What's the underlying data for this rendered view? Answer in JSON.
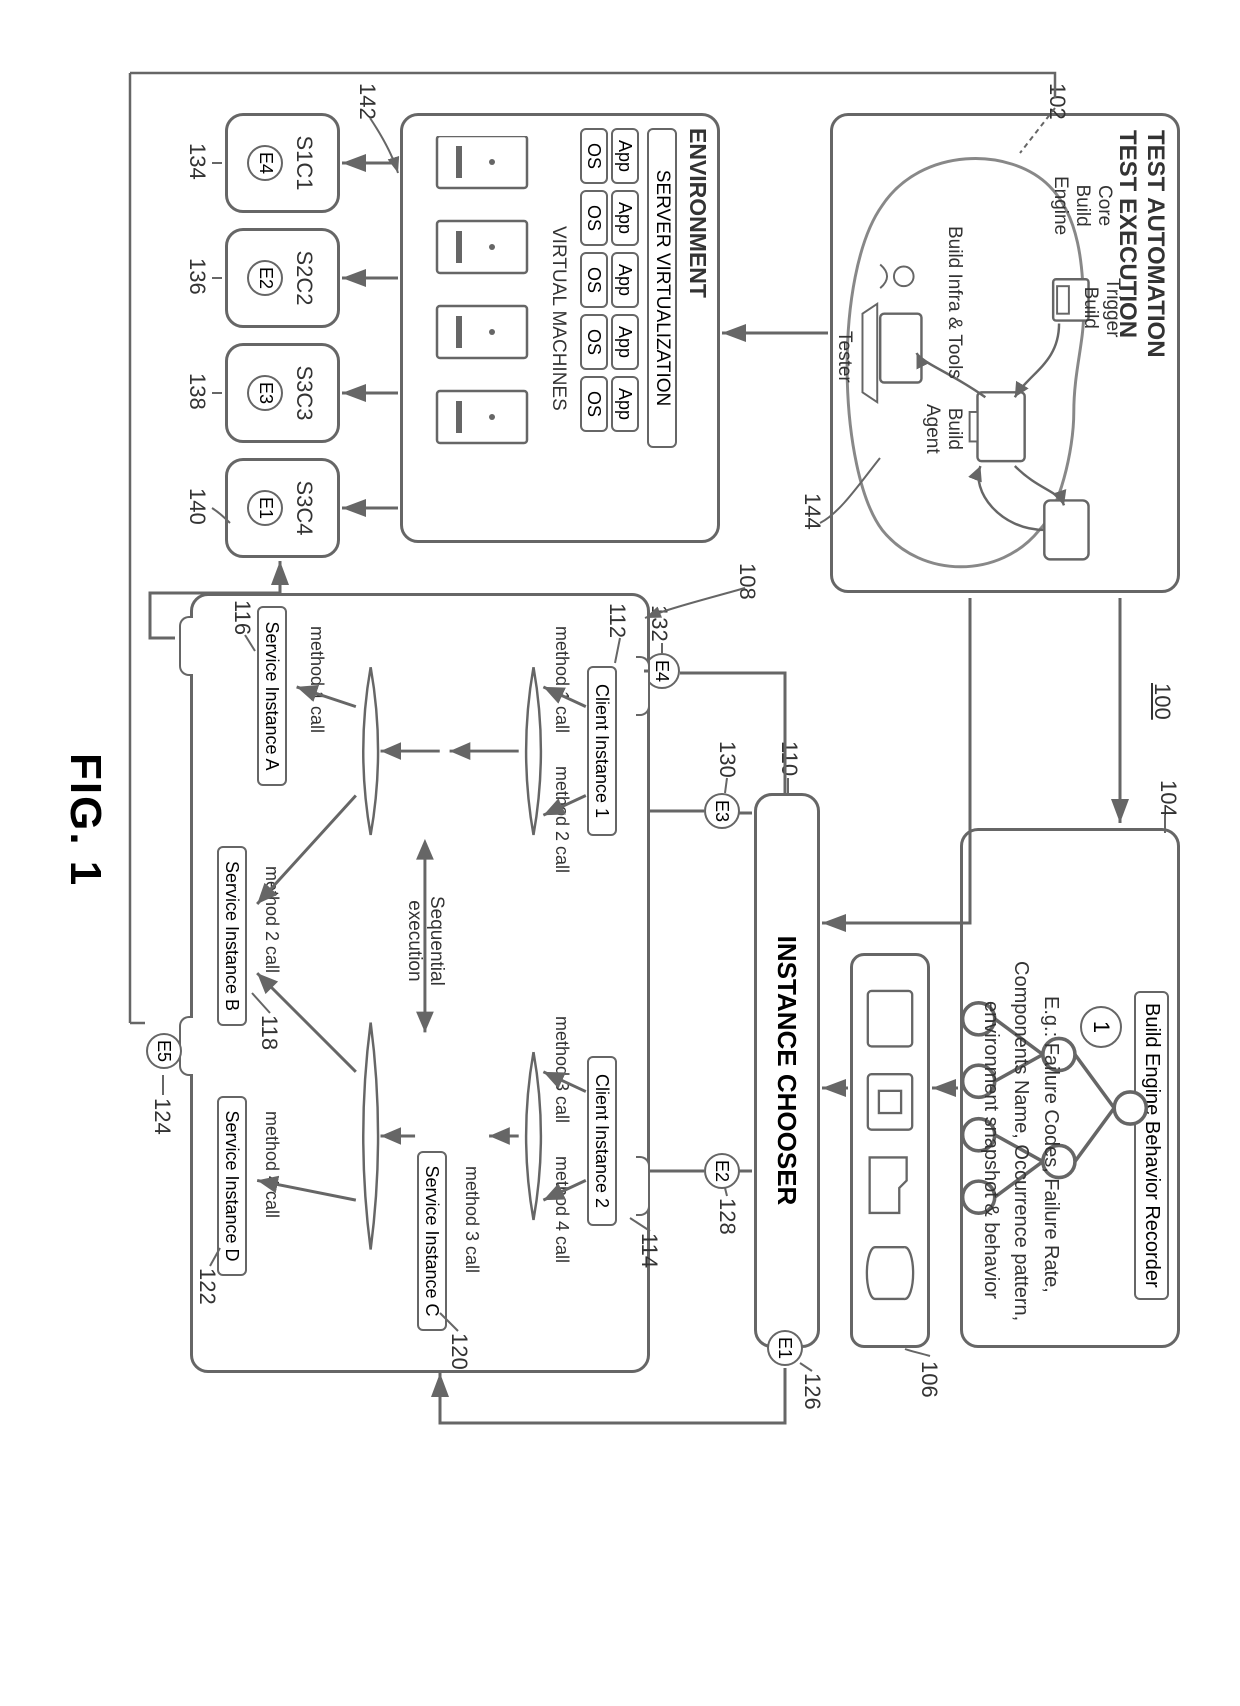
{
  "figure_caption": "FIG. 1",
  "system_ref": "100",
  "test_automation": {
    "title": "TEST AUTOMATION\nTEST EXECUTION",
    "ref": "102",
    "core_engine": "Core\nBuild\nEngine",
    "trigger_build": "Trigger\nBuild",
    "build_agent": "Build\nAgent",
    "build_infra": "Build Infra & Tools",
    "tester": "Tester",
    "ref_144": "144"
  },
  "recorder": {
    "title": "Build Engine Behavior Recorder",
    "ref": "104",
    "badge": "1",
    "eg_line1": "E.g.: Failure Codes, Failure Rate,",
    "eg_line2": "Components Name, Occurrence pattern,",
    "eg_line3": "environment snapshot & behavior"
  },
  "db": {
    "ref": "106"
  },
  "chooser": {
    "title": "INSTANCE CHOOSER",
    "ref": "110"
  },
  "env": {
    "title": "ENVIRONMENT",
    "server_virt": "SERVER VIRTUALIZATION",
    "app": "App",
    "os": "OS",
    "vm_label": "VIRTUAL MACHINES",
    "ref": "142"
  },
  "config_boxes": {
    "s1c1": "S1C1",
    "s2c2": "S2C2",
    "s3c3": "S3C3",
    "s3c4": "S3C4",
    "ref_134": "134",
    "ref_136": "136",
    "ref_138": "138",
    "ref_140": "140",
    "e1": "E1",
    "e2": "E2",
    "e3": "E3",
    "e4": "E4"
  },
  "calls_panel": {
    "ref": "108",
    "client1": "Client Instance 1",
    "client2": "Client Instance 2",
    "serviceA": "Service Instance A",
    "serviceB": "Service Instance B",
    "serviceC": "Service Instance C",
    "serviceD": "Service Instance D",
    "m1": "method 1 call",
    "m2": "method 2 call",
    "m3": "method 3 call",
    "m4": "method 4 call",
    "seq": "Sequential\nexecution",
    "ref_112": "112",
    "ref_114": "114",
    "ref_116": "116",
    "ref_118": "118",
    "ref_120": "120",
    "ref_122": "122",
    "ref_124": "124",
    "ref_E5": "E5"
  },
  "e_labels": {
    "e1": "E1",
    "e2": "E2",
    "e3": "E3",
    "e4": "E4",
    "ref_126": "126",
    "ref_128": "128",
    "ref_130": "130",
    "ref_132": "132"
  }
}
